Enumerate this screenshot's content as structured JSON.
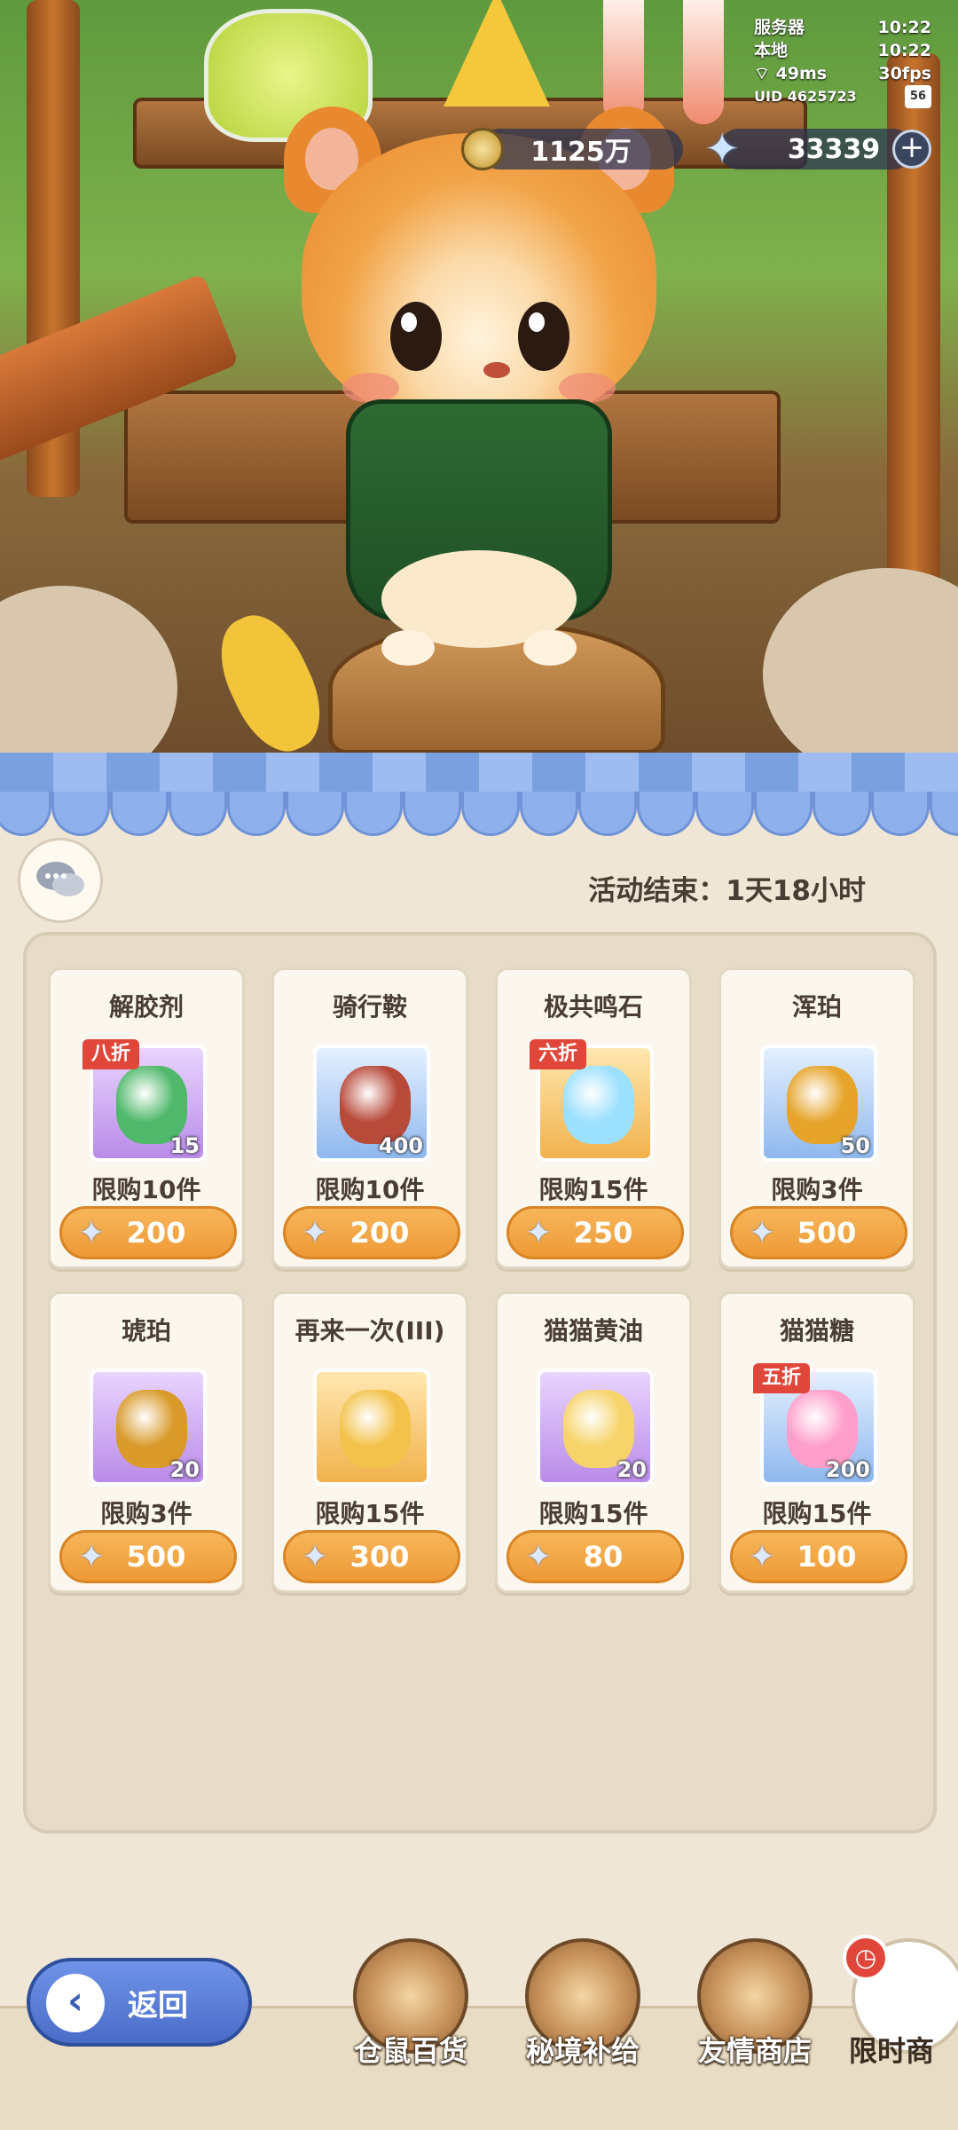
{
  "status": {
    "server_label": "服务器",
    "server_time": "10:22",
    "local_label": "本地",
    "local_time": "10:22",
    "ping": "49ms",
    "fps": "30fps",
    "uid": "UID 4625723",
    "badge": "56"
  },
  "currency": {
    "coins": "1125万",
    "stars": "33339"
  },
  "shop": {
    "countdown": "活动结束：1天18小时",
    "items": [
      {
        "name": "解胶剂",
        "qty": "15",
        "discount": "八折",
        "limit": "限购10件",
        "price": "200",
        "rarity": "purple"
      },
      {
        "name": "骑行鞍",
        "qty": "400",
        "discount": "",
        "limit": "限购10件",
        "price": "200",
        "rarity": "blue"
      },
      {
        "name": "极共鸣石",
        "qty": "",
        "discount": "六折",
        "limit": "限购15件",
        "price": "250",
        "rarity": "gold"
      },
      {
        "name": "浑珀",
        "qty": "50",
        "discount": "",
        "limit": "限购3件",
        "price": "500",
        "rarity": "blue"
      },
      {
        "name": "琥珀",
        "qty": "20",
        "discount": "",
        "limit": "限购3件",
        "price": "500",
        "rarity": "purple"
      },
      {
        "name": "再来一次(III)",
        "qty": "",
        "discount": "",
        "limit": "限购15件",
        "price": "300",
        "rarity": "gold"
      },
      {
        "name": "猫猫黄油",
        "qty": "20",
        "discount": "",
        "limit": "限购15件",
        "price": "80",
        "rarity": "purple"
      },
      {
        "name": "猫猫糖",
        "qty": "200",
        "discount": "五折",
        "limit": "限购15件",
        "price": "100",
        "rarity": "blue"
      }
    ]
  },
  "nav": {
    "back_label": "返回",
    "tabs": [
      {
        "label": "仓鼠百货",
        "icon": "hamster-icon"
      },
      {
        "label": "秘境补给",
        "icon": "eye-emblem-icon"
      },
      {
        "label": "友情商店",
        "icon": "crystal-ball-icon"
      },
      {
        "label": "限时商",
        "icon": "market-stall-icon"
      }
    ]
  },
  "colors": {
    "price_orange": "#ee9a36",
    "discount_red": "#e0473a",
    "awning_blue": "#8eb0ec",
    "back_blue": "#4a6cc8"
  }
}
